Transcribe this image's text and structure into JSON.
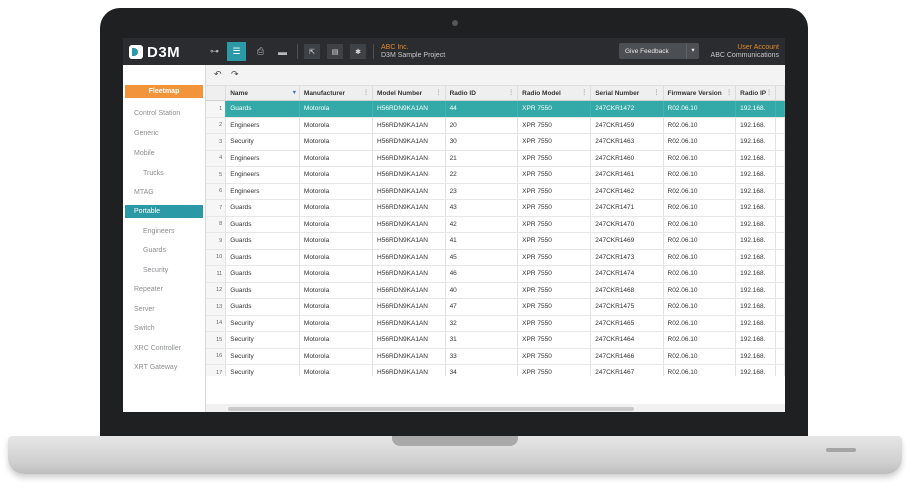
{
  "app": {
    "logo_text": "D3M",
    "org": "ABC Inc.",
    "project": "D3M Sample Project",
    "feedback_label": "Give Feedback",
    "account_label": "User Account",
    "account_company": "ABC Communications"
  },
  "toolbar": {
    "icons": [
      "sitemap-icon",
      "list-icon",
      "print-icon",
      "folder-icon",
      "export-icon",
      "book-icon",
      "gear-icon"
    ],
    "glyphs": {
      "sitemap": "⊶",
      "list": "☰",
      "print": "⎙",
      "folder": "▬",
      "export": "⇱",
      "book": "▤",
      "gear": "✱"
    }
  },
  "sidebar": {
    "header": "Fleetmap",
    "items": [
      {
        "label": "Control Station",
        "indent": false,
        "active": false
      },
      {
        "label": "Generic",
        "indent": false,
        "active": false
      },
      {
        "label": "Mobile",
        "indent": false,
        "active": false
      },
      {
        "label": "Trucks",
        "indent": true,
        "active": false
      },
      {
        "label": "MTAG",
        "indent": false,
        "active": false
      },
      {
        "label": "Portable",
        "indent": false,
        "active": true
      },
      {
        "label": "Engineers",
        "indent": true,
        "active": false
      },
      {
        "label": "Guards",
        "indent": true,
        "active": false
      },
      {
        "label": "Security",
        "indent": true,
        "active": false
      },
      {
        "label": "Repeater",
        "indent": false,
        "active": false
      },
      {
        "label": "Server",
        "indent": false,
        "active": false
      },
      {
        "label": "Switch",
        "indent": false,
        "active": false
      },
      {
        "label": "XRC Controller",
        "indent": false,
        "active": false
      },
      {
        "label": "XRT Gateway",
        "indent": false,
        "active": false
      }
    ]
  },
  "grid_tools": {
    "undo": "↶",
    "redo": "↷"
  },
  "table": {
    "columns": [
      "Name",
      "Manufacturer",
      "Model Number",
      "Radio ID",
      "Radio Model",
      "Serial Number",
      "Firmware Version",
      "Radio IP"
    ],
    "selected_row": 0,
    "rows": [
      [
        "Guards",
        "Motorola",
        "H56RDN9KA1AN",
        "44",
        "XPR 7550",
        "247CKR1472",
        "R02.06.10",
        "192.168."
      ],
      [
        "Engineers",
        "Motorola",
        "H56RDN9KA1AN",
        "20",
        "XPR 7550",
        "247CKR1459",
        "R02.06.10",
        "192.168."
      ],
      [
        "Security",
        "Motorola",
        "H56RDN9KA1AN",
        "30",
        "XPR 7550",
        "247CKR1463",
        "R02.06.10",
        "192.168."
      ],
      [
        "Engineers",
        "Motorola",
        "H56RDN9KA1AN",
        "21",
        "XPR 7550",
        "247CKR1460",
        "R02.06.10",
        "192.168."
      ],
      [
        "Engineers",
        "Motorola",
        "H56RDN9KA1AN",
        "22",
        "XPR 7550",
        "247CKR1461",
        "R02.06.10",
        "192.168."
      ],
      [
        "Engineers",
        "Motorola",
        "H56RDN9KA1AN",
        "23",
        "XPR 7550",
        "247CKR1462",
        "R02.06.10",
        "192.168."
      ],
      [
        "Guards",
        "Motorola",
        "H56RDN9KA1AN",
        "43",
        "XPR 7550",
        "247CKR1471",
        "R02.06.10",
        "192.168."
      ],
      [
        "Guards",
        "Motorola",
        "H56RDN9KA1AN",
        "42",
        "XPR 7550",
        "247CKR1470",
        "R02.06.10",
        "192.168."
      ],
      [
        "Guards",
        "Motorola",
        "H56RDN9KA1AN",
        "41",
        "XPR 7550",
        "247CKR1469",
        "R02.06.10",
        "192.168."
      ],
      [
        "Guards",
        "Motorola",
        "H56RDN9KA1AN",
        "45",
        "XPR 7550",
        "247CKR1473",
        "R02.06.10",
        "192.168."
      ],
      [
        "Guards",
        "Motorola",
        "H56RDN9KA1AN",
        "46",
        "XPR 7550",
        "247CKR1474",
        "R02.06.10",
        "192.168."
      ],
      [
        "Guards",
        "Motorola",
        "H56RDN9KA1AN",
        "40",
        "XPR 7550",
        "247CKR1468",
        "R02.06.10",
        "192.168."
      ],
      [
        "Guards",
        "Motorola",
        "H56RDN9KA1AN",
        "47",
        "XPR 7550",
        "247CKR1475",
        "R02.06.10",
        "192.168."
      ],
      [
        "Security",
        "Motorola",
        "H56RDN9KA1AN",
        "32",
        "XPR 7550",
        "247CKR1465",
        "R02.06.10",
        "192.168."
      ],
      [
        "Security",
        "Motorola",
        "H56RDN9KA1AN",
        "31",
        "XPR 7550",
        "247CKR1464",
        "R02.06.10",
        "192.168."
      ],
      [
        "Security",
        "Motorola",
        "H56RDN9KA1AN",
        "33",
        "XPR 7550",
        "247CKR1466",
        "R02.06.10",
        "192.168."
      ],
      [
        "Security",
        "Motorola",
        "H56RDN9KA1AN",
        "34",
        "XPR 7550",
        "247CKR1467",
        "R02.06.10",
        "192.168."
      ]
    ]
  },
  "colors": {
    "accent": "#2c9aa6",
    "highlight": "#f2953a",
    "topbar": "#2a2c2f",
    "selected_row": "#33a9a8"
  }
}
